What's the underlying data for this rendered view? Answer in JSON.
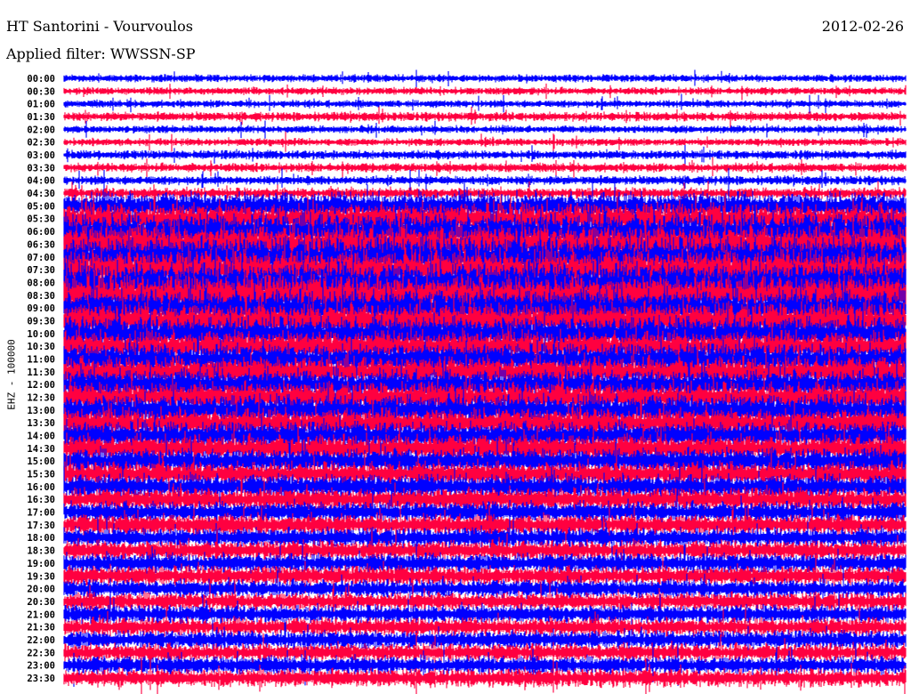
{
  "header": {
    "station": "HT Santorini - Vourvoulos",
    "date": "2012-02-26",
    "filter": "Applied filter: WWSSN-SP"
  },
  "chart_data": {
    "type": "line",
    "subtype": "helicorder",
    "title": "HT Santorini - Vourvoulos",
    "ylabel": "EHZ - 100000",
    "row_minutes": 30,
    "colors": [
      "#0000ff",
      "#ff0040"
    ],
    "rows": [
      "00:00",
      "00:30",
      "01:00",
      "01:30",
      "02:00",
      "02:30",
      "03:00",
      "03:30",
      "04:00",
      "04:30",
      "05:00",
      "05:30",
      "06:00",
      "06:30",
      "07:00",
      "07:30",
      "08:00",
      "08:30",
      "09:00",
      "09:30",
      "10:00",
      "10:30",
      "11:00",
      "11:30",
      "12:00",
      "12:30",
      "13:00",
      "13:30",
      "14:00",
      "14:30",
      "15:00",
      "15:30",
      "16:00",
      "16:30",
      "17:00",
      "17:30",
      "18:00",
      "18:30",
      "19:00",
      "19:30",
      "20:00",
      "20:30",
      "21:00",
      "21:30",
      "22:00",
      "22:30",
      "23:00",
      "23:30"
    ],
    "relative_amplitude": [
      0.25,
      0.25,
      0.25,
      0.3,
      0.25,
      0.25,
      0.3,
      0.3,
      0.3,
      0.35,
      0.9,
      1,
      1.2,
      1.3,
      1.3,
      1.3,
      1.3,
      1.3,
      1.2,
      1.2,
      1.1,
      1,
      1,
      1,
      1,
      1,
      1,
      0.95,
      0.9,
      0.9,
      0.85,
      0.8,
      0.8,
      0.75,
      0.7,
      0.7,
      0.65,
      0.65,
      0.65,
      0.65,
      0.6,
      0.6,
      0.6,
      0.6,
      0.6,
      0.6,
      0.6,
      0.6
    ]
  }
}
